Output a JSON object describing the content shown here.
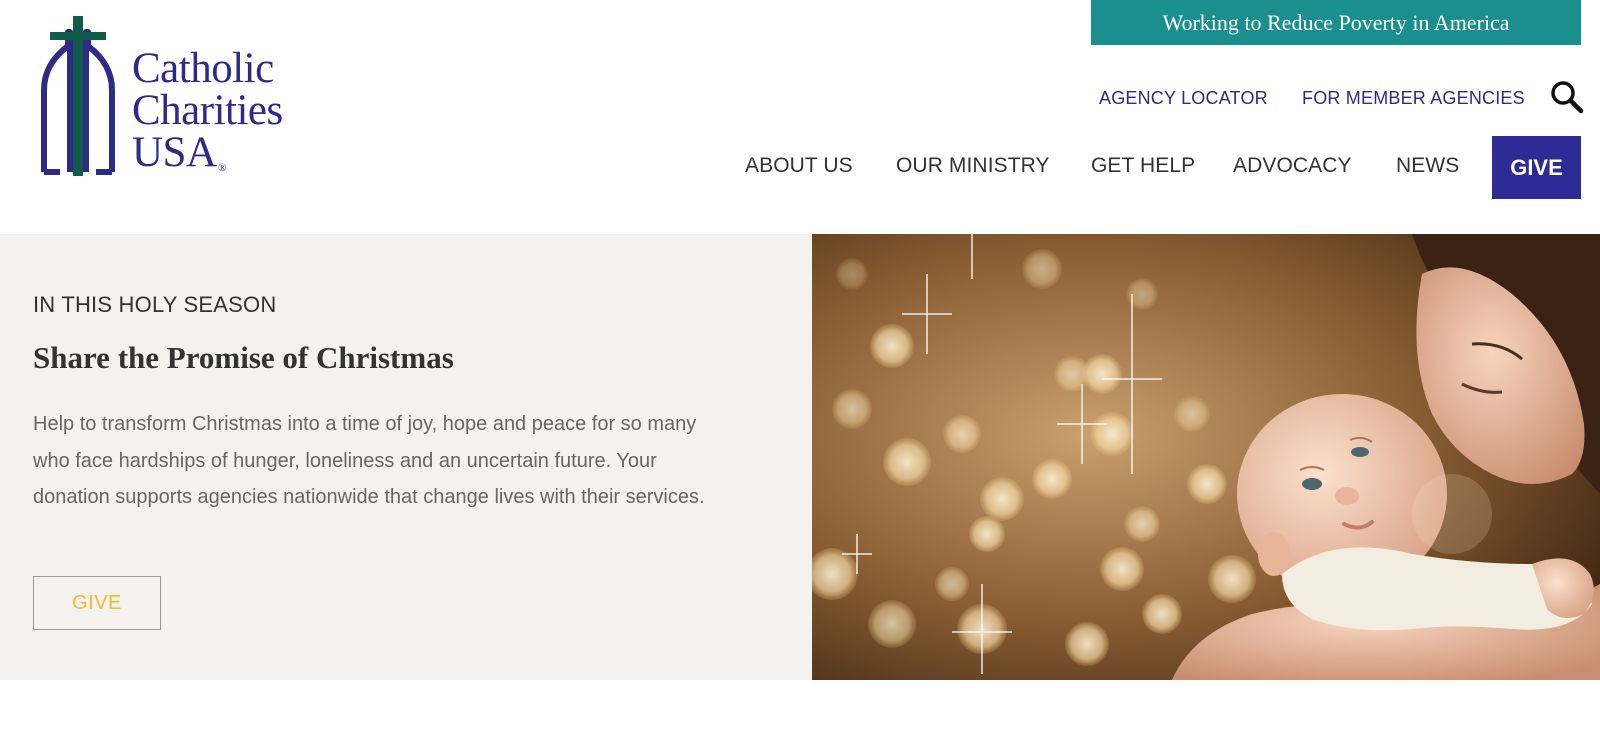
{
  "header": {
    "logo": {
      "line1": "Catholic",
      "line2": "Charities",
      "line3": "USA",
      "reg": "®"
    },
    "banner": "Working to Reduce Poverty in America",
    "utility_nav": {
      "agency_locator": "AGENCY LOCATOR",
      "member_agencies": "FOR MEMBER AGENCIES"
    },
    "main_nav": {
      "about": "ABOUT US",
      "ministry": "OUR MINISTRY",
      "help": "GET HELP",
      "advocacy": "ADVOCACY",
      "news": "NEWS",
      "give": "GIVE"
    },
    "search_icon": "search-icon"
  },
  "hero": {
    "eyebrow": "IN THIS HOLY SEASON",
    "title": "Share the Promise of Christmas",
    "body": "Help to transform Christmas into a time of joy, hope and peace for so many who face hardships of hunger, loneliness and an uncertain future. Your donation supports agencies nationwide that change lives with their services.",
    "button": "GIVE"
  },
  "colors": {
    "brand_purple": "#2e2a85",
    "give_button": "#2e2a96",
    "banner_teal": "#1b8f8e",
    "cross_green": "#0f5c4a",
    "hero_button_text": "#f5b82e",
    "hero_bg": "#f3f2ee"
  }
}
